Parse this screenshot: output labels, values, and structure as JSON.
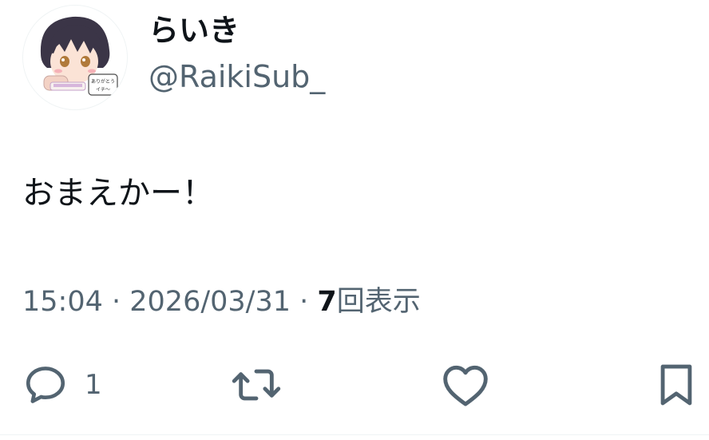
{
  "user": {
    "display_name": "らいき",
    "handle": "@RaikiSub_",
    "avatar_icon": "anime-avatar-icon",
    "avatar_note_line1": "ありがとう",
    "avatar_note_line2": "イチ〜"
  },
  "tweet": {
    "text": "おまえかー！"
  },
  "meta": {
    "time": "15:04",
    "separator": " · ",
    "date": "2026/03/31",
    "views_count": "7",
    "views_label": "回表示"
  },
  "actions": {
    "reply_icon": "reply-icon",
    "reply_count": "1",
    "retweet_icon": "retweet-icon",
    "like_icon": "heart-icon",
    "bookmark_icon": "bookmark-icon"
  },
  "colors": {
    "primary_text": "#0f1419",
    "secondary_text": "#536471",
    "divider": "#eff3f4"
  }
}
